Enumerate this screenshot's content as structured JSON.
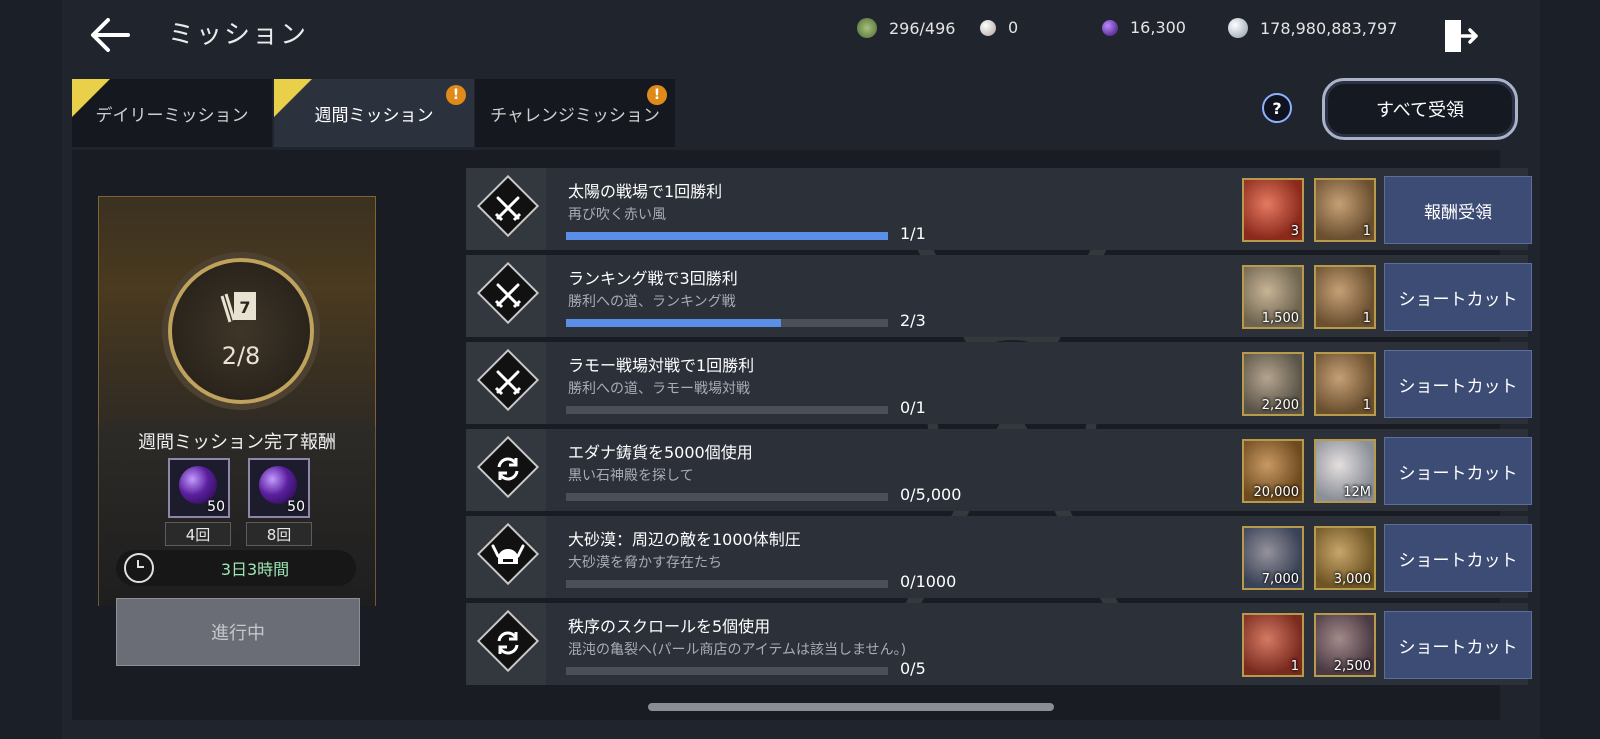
{
  "header": {
    "title": "ミッション",
    "resources": [
      {
        "name": "stamina",
        "icon": "green-gem-icon",
        "value": "296/496",
        "color": "#6f8a4a"
      },
      {
        "name": "pearl",
        "icon": "pearl-icon",
        "value": "0",
        "color": "#d8d2cc"
      },
      {
        "name": "purple-crystal",
        "icon": "purple-orb-icon",
        "value": "16,300",
        "color": "#6a2fc0"
      },
      {
        "name": "silver",
        "icon": "silver-coin-icon",
        "value": "178,980,883,797",
        "color": "#c9d3df"
      }
    ]
  },
  "tabs": [
    {
      "label": "デイリーミッション",
      "active": false,
      "new": true,
      "alert": false
    },
    {
      "label": "週間ミッション",
      "active": true,
      "new": true,
      "alert": true
    },
    {
      "label": "チャレンジミッション",
      "active": false,
      "new": false,
      "alert": true
    }
  ],
  "alert_mark": "!",
  "help_mark": "?",
  "claim_all_label": "すべて受領",
  "card": {
    "progress": "2/8",
    "title": "週間ミッション完了報酬",
    "rewards": [
      {
        "qty": "50",
        "times": "4回"
      },
      {
        "qty": "50",
        "times": "8回"
      }
    ],
    "timer": "3日3時間",
    "button": "進行中",
    "book_number": "7"
  },
  "missions": [
    {
      "name": "太陽の戦場で1回勝利",
      "sub": "再び吹く赤い風",
      "progress": "1/1",
      "fraction": 1.0,
      "icon": "crossed-swords-icon",
      "items": [
        {
          "icon": "red-crystal-icon",
          "qty": "3",
          "bg": "#8b2a1c"
        },
        {
          "icon": "medal-icon",
          "qty": "1",
          "bg": "#6b5030"
        }
      ],
      "action": "報酬受領"
    },
    {
      "name": "ランキング戦で3回勝利",
      "sub": "勝利への道、ランキング戦",
      "progress": "2/3",
      "fraction": 0.667,
      "icon": "crossed-swords-icon",
      "items": [
        {
          "icon": "scroll-icon",
          "qty": "1,500",
          "bg": "#6e6450"
        },
        {
          "icon": "medal-icon",
          "qty": "1",
          "bg": "#6b5030"
        }
      ],
      "action": "ショートカット"
    },
    {
      "name": "ラモー戦場対戦で1回勝利",
      "sub": "勝利への道、ラモー戦場対戦",
      "progress": "0/1",
      "fraction": 0,
      "icon": "crossed-swords-icon",
      "items": [
        {
          "icon": "stone-tablet-icon",
          "qty": "2,200",
          "bg": "#5a5448"
        },
        {
          "icon": "medal-icon",
          "qty": "1",
          "bg": "#6b5030"
        }
      ],
      "action": "ショートカット"
    },
    {
      "name": "エダナ鋳貨を5000個使用",
      "sub": "黒い石神殿を探して",
      "progress": "0/5,000",
      "fraction": 0,
      "icon": "cycle-icon",
      "items": [
        {
          "icon": "gold-pile-icon",
          "qty": "20,000",
          "bg": "#6e4a1e"
        },
        {
          "icon": "silver-coin-icon",
          "qty": "12M",
          "bg": "#8a8f98"
        }
      ],
      "action": "ショートカット"
    },
    {
      "name": "大砂漠：周辺の敵を1000体制圧",
      "sub": "大砂漠を脅かす存在たち",
      "progress": "0/1000",
      "fraction": 0,
      "icon": "horned-helmet-icon",
      "items": [
        {
          "icon": "ingot-icon",
          "qty": "7,000",
          "bg": "#3a4256"
        },
        {
          "icon": "gold-coin-icon",
          "qty": "3,000",
          "bg": "#6e5524"
        }
      ],
      "action": "ショートカット"
    },
    {
      "name": "秩序のスクロールを5個使用",
      "sub": "混沌の亀裂へ(パール商店のアイテムは該当しません。)",
      "progress": "0/5",
      "fraction": 0,
      "icon": "cycle-icon",
      "items": [
        {
          "icon": "blue-orb-icon",
          "qty": "1",
          "bg": "#7a2a1e"
        },
        {
          "icon": "gear-coin-icon",
          "qty": "2,500",
          "bg": "#4a3a44"
        }
      ],
      "action": "ショートカット"
    }
  ]
}
